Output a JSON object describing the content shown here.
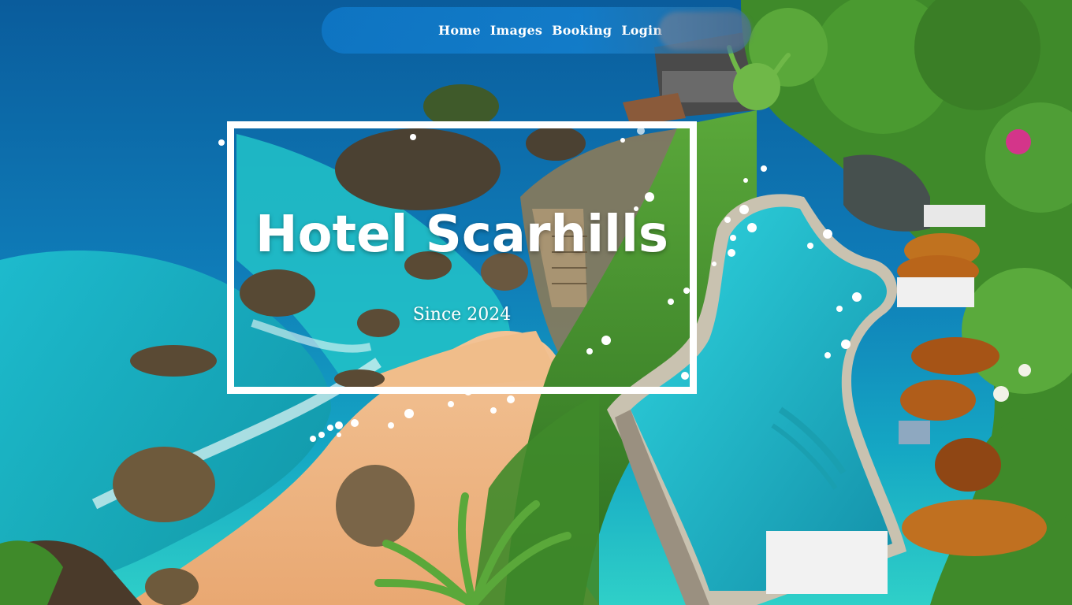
{
  "nav": {
    "items": [
      {
        "label": "Home"
      },
      {
        "label": "Images"
      },
      {
        "label": "Booking"
      },
      {
        "label": "Login"
      }
    ]
  },
  "hero": {
    "title": "Hotel Scarhills",
    "subtitle": "Since 2024"
  },
  "colors": {
    "sea": "#0f6fae",
    "lagoon": "#24c6c0",
    "sand": "#efb985",
    "foliage": "#3d8a2a",
    "nav_bg": "#1482d2",
    "text": "#ffffff"
  }
}
